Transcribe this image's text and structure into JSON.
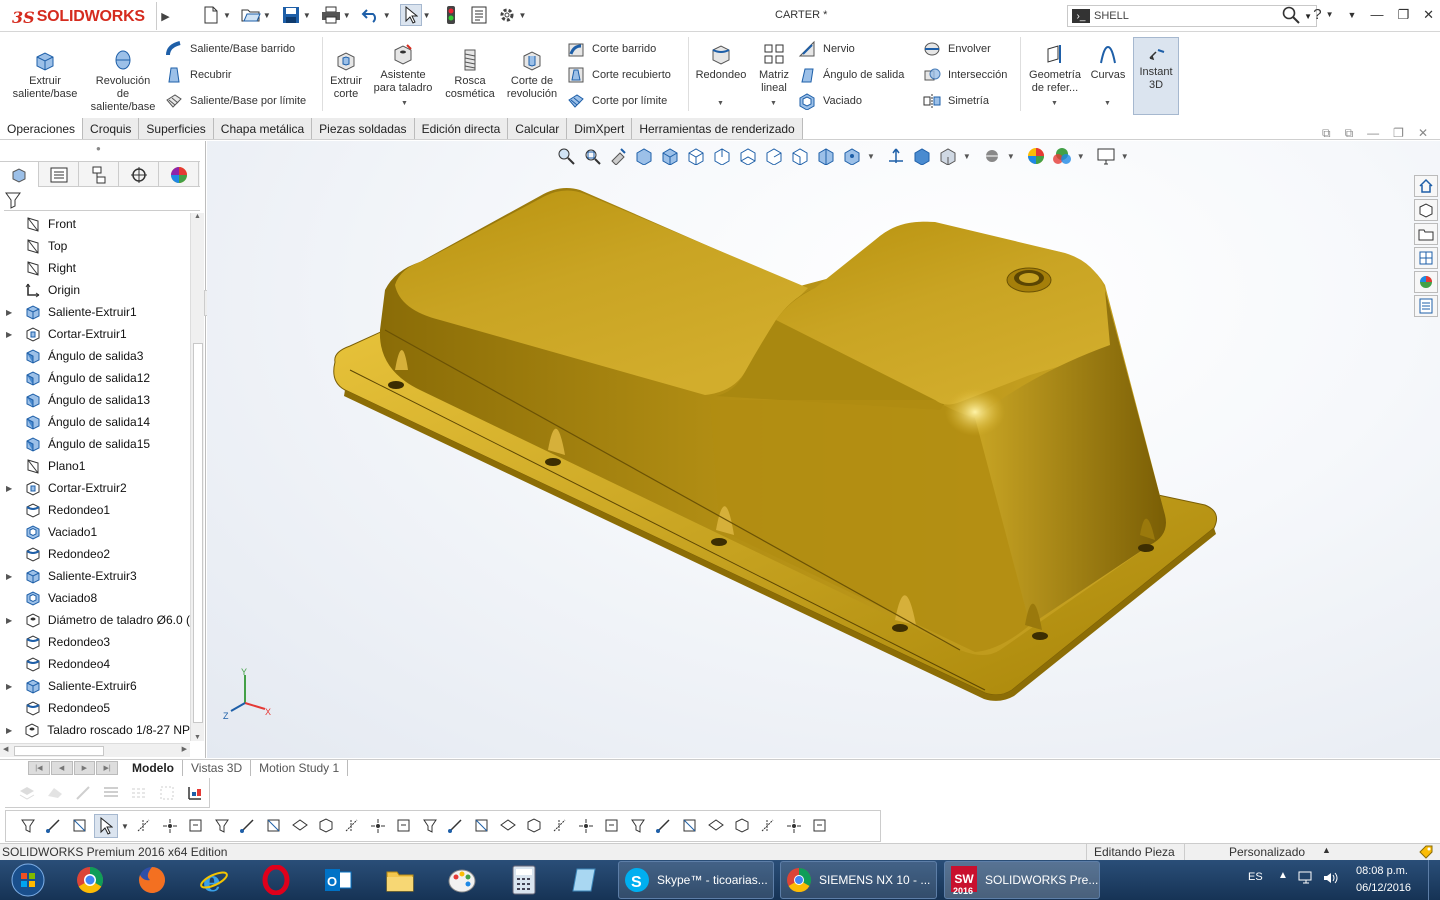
{
  "app": {
    "brand_ds": "3S",
    "brand_name": "SOLIDWORKS",
    "document_title": "CARTER *",
    "search_placeholder": "SHELL",
    "help_label": "?"
  },
  "command_manager": {
    "extruir_saliente": "Extruir\nsaliente/base",
    "revolucion_saliente": "Revolución\nde\nsaliente/base",
    "saliente_barrido": "Saliente/Base barrido",
    "recubrir": "Recubrir",
    "saliente_limite": "Saliente/Base por límite",
    "extruir_corte": "Extruir\ncorte",
    "asistente_taladro": "Asistente\npara taladro",
    "rosca_cosmetica": "Rosca\ncosmética",
    "corte_revolucion": "Corte de\nrevolución",
    "corte_barrido": "Corte barrido",
    "corte_recubierto": "Corte recubierto",
    "corte_limite": "Corte por límite",
    "redondeo": "Redondeo",
    "matriz_lineal": "Matriz\nlineal",
    "nervio": "Nervio",
    "angulo_salida": "Ángulo de salida",
    "vaciado": "Vaciado",
    "envolver": "Envolver",
    "interseccion": "Intersección",
    "simetria": "Simetría",
    "geometria_referencia": "Geometría\nde refer...",
    "curvas": "Curvas",
    "instant3d": "Instant\n3D"
  },
  "tabs": [
    "Operaciones",
    "Croquis",
    "Superficies",
    "Chapa metálica",
    "Piezas soldadas",
    "Edición directa",
    "Calcular",
    "DimXpert",
    "Herramientas de renderizado"
  ],
  "tree": [
    {
      "label": "Front",
      "icon": "plane",
      "expandable": false
    },
    {
      "label": "Top",
      "icon": "plane",
      "expandable": false
    },
    {
      "label": "Right",
      "icon": "plane",
      "expandable": false
    },
    {
      "label": "Origin",
      "icon": "origin",
      "expandable": false
    },
    {
      "label": "Saliente-Extruir1",
      "icon": "extrude",
      "expandable": true
    },
    {
      "label": "Cortar-Extruir1",
      "icon": "cut",
      "expandable": true
    },
    {
      "label": "Ángulo de salida3",
      "icon": "draft",
      "expandable": false
    },
    {
      "label": "Ángulo de salida12",
      "icon": "draft",
      "expandable": false
    },
    {
      "label": "Ángulo de salida13",
      "icon": "draft",
      "expandable": false
    },
    {
      "label": "Ángulo de salida14",
      "icon": "draft",
      "expandable": false
    },
    {
      "label": "Ángulo de salida15",
      "icon": "draft",
      "expandable": false
    },
    {
      "label": "Plano1",
      "icon": "plane",
      "expandable": false
    },
    {
      "label": "Cortar-Extruir2",
      "icon": "cut",
      "expandable": true
    },
    {
      "label": "Redondeo1",
      "icon": "fillet",
      "expandable": false
    },
    {
      "label": "Vaciado1",
      "icon": "shell",
      "expandable": false
    },
    {
      "label": "Redondeo2",
      "icon": "fillet",
      "expandable": false
    },
    {
      "label": "Saliente-Extruir3",
      "icon": "extrude",
      "expandable": true
    },
    {
      "label": "Vaciado8",
      "icon": "shell",
      "expandable": false
    },
    {
      "label": "Diámetro de taladro Ø6.0 (",
      "icon": "hole",
      "expandable": true
    },
    {
      "label": "Redondeo3",
      "icon": "fillet",
      "expandable": false
    },
    {
      "label": "Redondeo4",
      "icon": "fillet",
      "expandable": false
    },
    {
      "label": "Saliente-Extruir6",
      "icon": "extrude",
      "expandable": true
    },
    {
      "label": "Redondeo5",
      "icon": "fillet",
      "expandable": false
    },
    {
      "label": "Taladro roscado 1/8-27 NP",
      "icon": "hole",
      "expandable": true
    }
  ],
  "bottom_tabs": [
    "Modelo",
    "Vistas 3D",
    "Motion Study 1"
  ],
  "status": {
    "edition": "SOLIDWORKS Premium 2016 x64 Edition",
    "mode": "Editando Pieza",
    "units": "Personalizado"
  },
  "taskbar": {
    "skype": "Skype™ - ticoarias...",
    "siemens": "SIEMENS NX 10 - ...",
    "solidworks": "SOLIDWORKS Pre...",
    "sw_year": "2016",
    "lang": "ES",
    "time": "08:08 p.m.",
    "date": "06/12/2016"
  },
  "triad": {
    "x": "X",
    "y": "Y",
    "z": "Z"
  },
  "colors": {
    "part_yellow": "#c9a423",
    "part_dark": "#7a5e05",
    "brand_red": "#d52b1e",
    "cmd_blue": "#1e5fa8"
  }
}
